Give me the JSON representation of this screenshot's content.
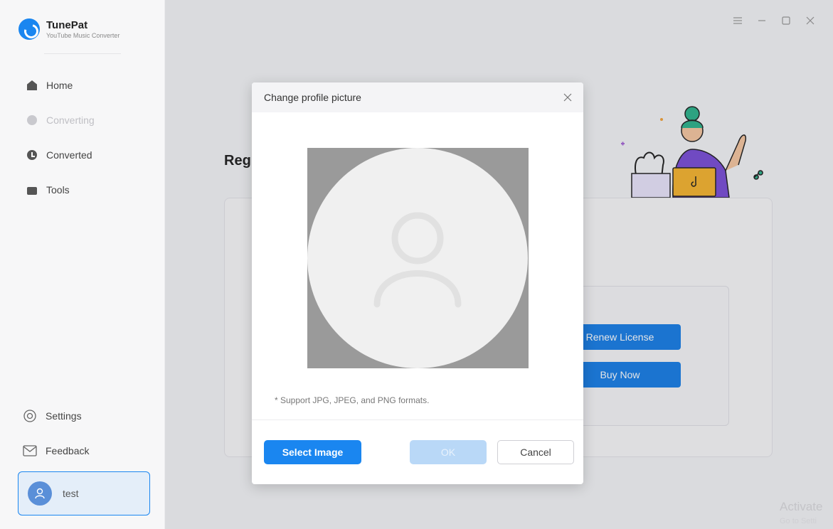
{
  "app": {
    "name": "TunePat",
    "subtitle": "YouTube Music Converter"
  },
  "sidebar": {
    "items": [
      {
        "label": "Home",
        "icon": "home-icon"
      },
      {
        "label": "Converting",
        "icon": "converting-icon"
      },
      {
        "label": "Converted",
        "icon": "converted-icon"
      },
      {
        "label": "Tools",
        "icon": "tools-icon"
      }
    ],
    "bottom": [
      {
        "label": "Settings",
        "icon": "gear-icon"
      },
      {
        "label": "Feedback",
        "icon": "mail-icon"
      }
    ],
    "user": {
      "name": "test",
      "icon": "user-icon"
    }
  },
  "window_controls": [
    "menu-icon",
    "minimize-icon",
    "maximize-icon",
    "close-icon"
  ],
  "main": {
    "heading_partial": "Reg",
    "renew_label": "Renew License",
    "buy_label": "Buy Now"
  },
  "modal": {
    "title": "Change profile picture",
    "support_text": "* Support JPG, JPEG, and PNG formats.",
    "select_label": "Select Image",
    "ok_label": "OK",
    "cancel_label": "Cancel"
  },
  "watermark": {
    "line1": "Activate",
    "line2": "Go to Setti"
  },
  "colors": {
    "accent": "#1a86f0",
    "ok_disabled": "#b9d8f7"
  }
}
